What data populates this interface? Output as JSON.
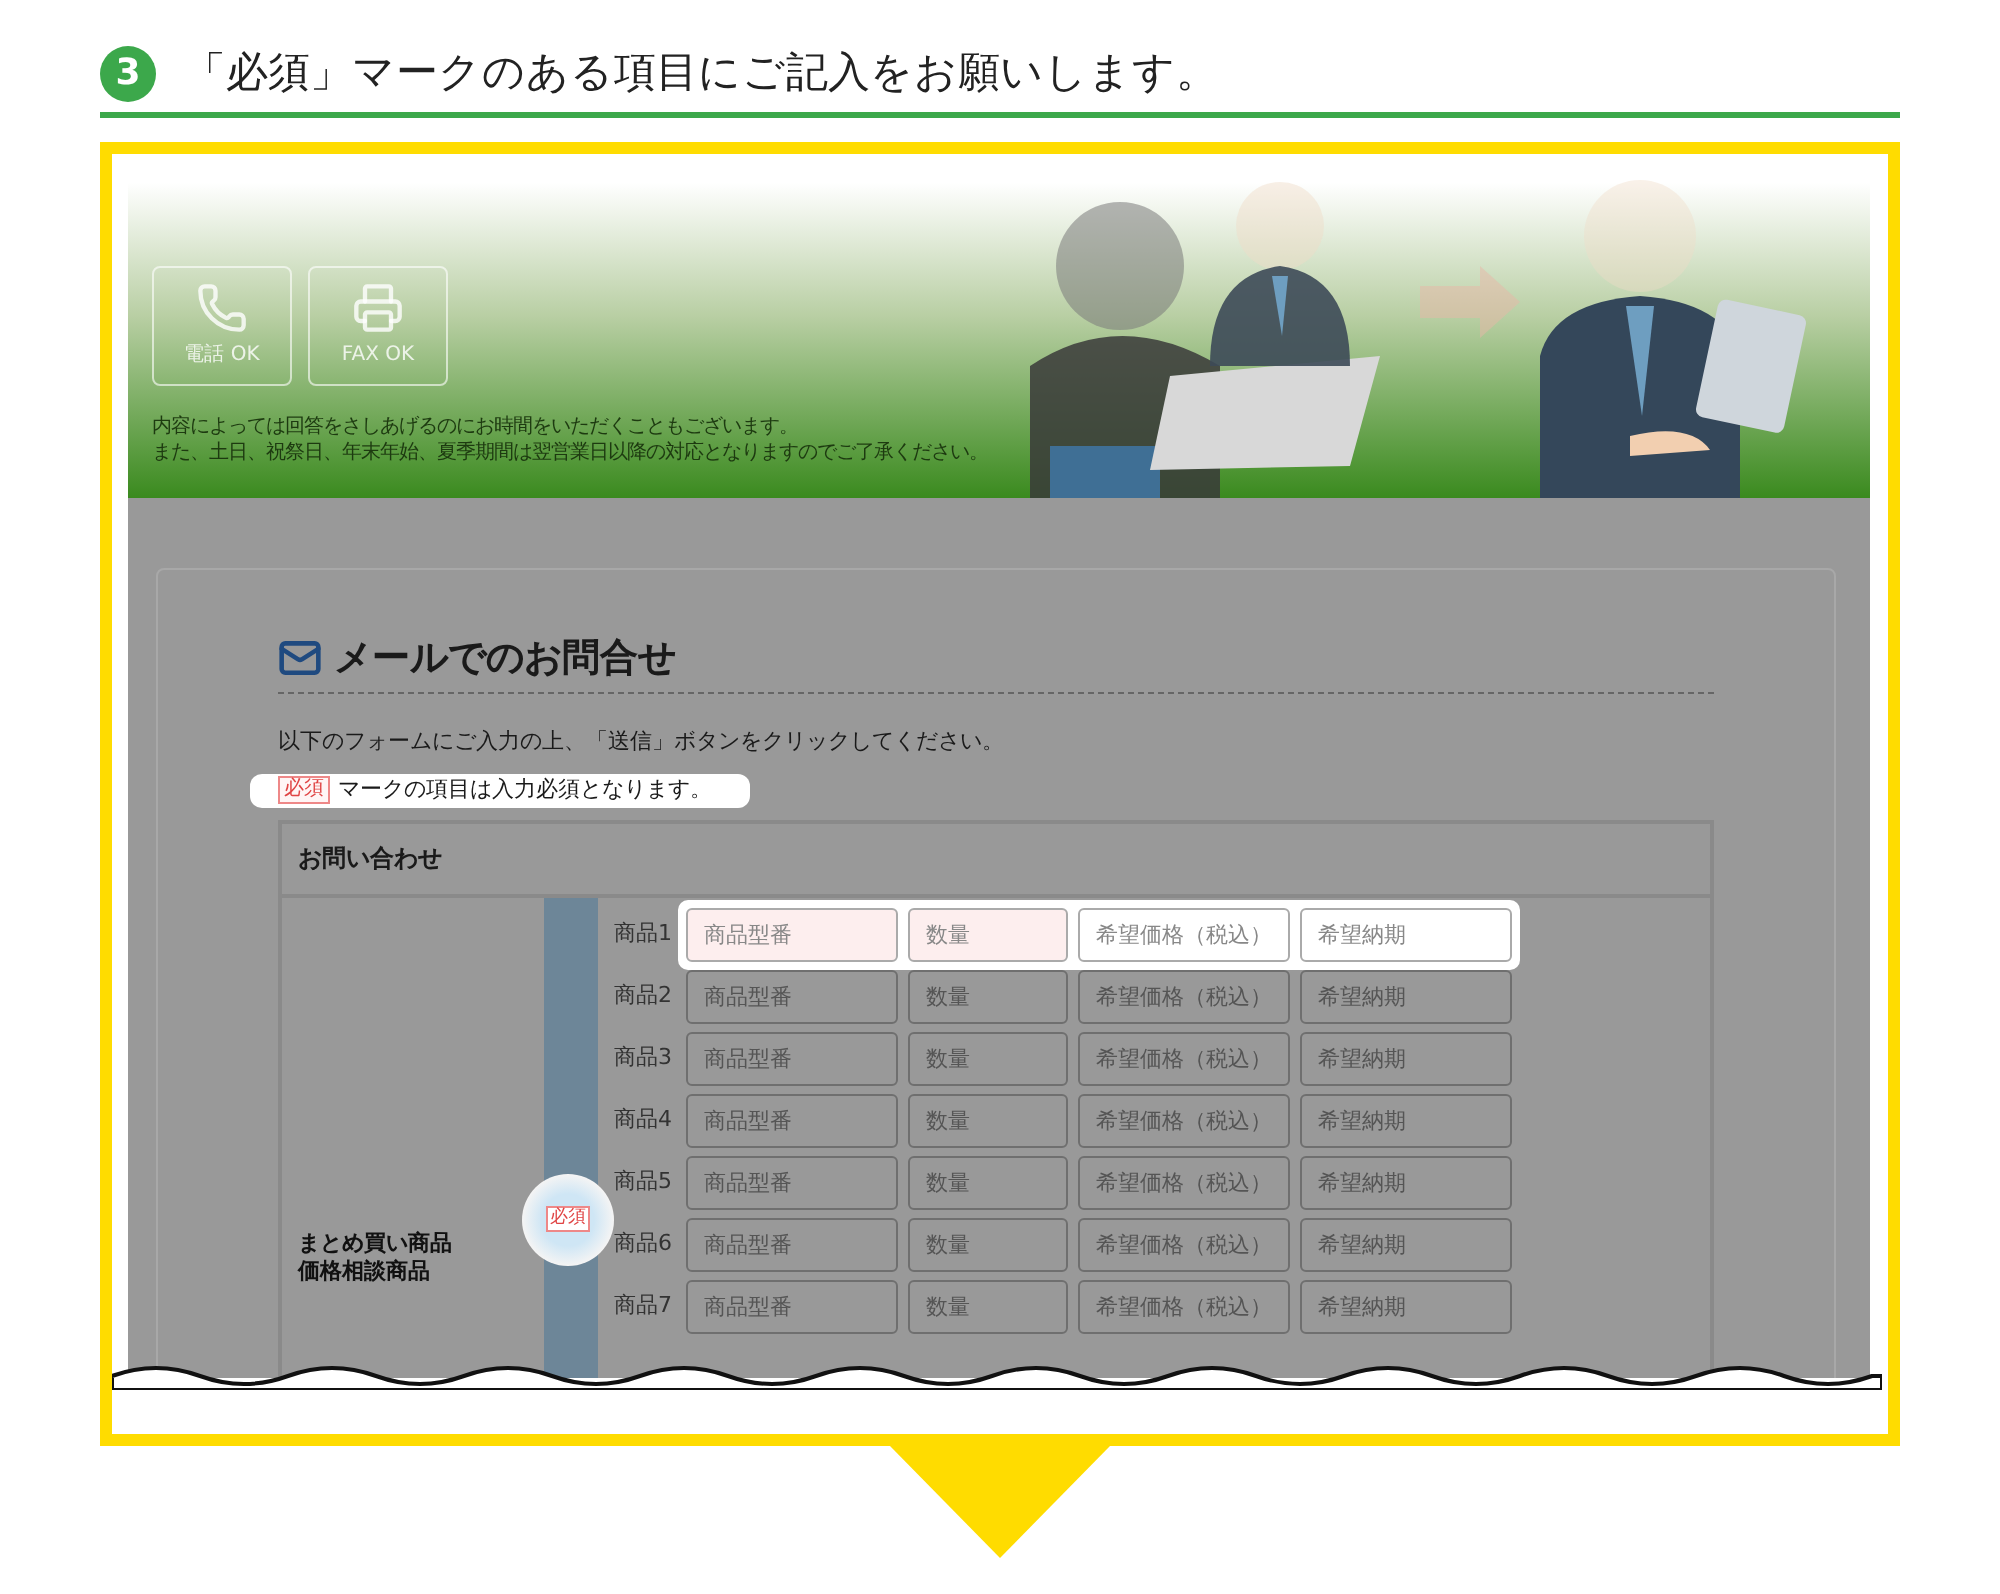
{
  "step": {
    "number": "3",
    "title": "「必須」マークのある項目にご記入をお願いします。"
  },
  "banner": {
    "contact_buttons": [
      {
        "kind": "phone",
        "label": "電話 OK"
      },
      {
        "kind": "fax",
        "label": "FAX OK"
      }
    ],
    "notes": [
      "内容によっては回答をさしあげるのにお時間をいただくこともございます。",
      "また、土日、祝祭日、年末年始、夏季期間は翌営業日以降の対応となりますのでご了承ください。"
    ]
  },
  "form": {
    "heading": "メールでのお問合せ",
    "instruction": "以下のフォームにご入力の上、「送信」ボタンをクリックしてください。",
    "required_note": {
      "badge": "必須",
      "text": "マークの項目は入力必須となります。",
      "highlighted": true
    },
    "section_title": "お問い合わせ",
    "group": {
      "label_lines": [
        "まとめ買い商品",
        "価格相談商品"
      ],
      "required_badge": "必須",
      "badge_highlighted": true,
      "rows": [
        {
          "label": "商品1",
          "highlighted": true,
          "fields": [
            {
              "placeholder": "商品型番",
              "required": true
            },
            {
              "placeholder": "数量",
              "required": true
            },
            {
              "placeholder": "希望価格（税込）",
              "required": false
            },
            {
              "placeholder": "希望納期",
              "required": false
            }
          ]
        },
        {
          "label": "商品2",
          "highlighted": false,
          "fields": [
            {
              "placeholder": "商品型番"
            },
            {
              "placeholder": "数量"
            },
            {
              "placeholder": "希望価格（税込）"
            },
            {
              "placeholder": "希望納期"
            }
          ]
        },
        {
          "label": "商品3",
          "highlighted": false,
          "fields": [
            {
              "placeholder": "商品型番"
            },
            {
              "placeholder": "数量"
            },
            {
              "placeholder": "希望価格（税込）"
            },
            {
              "placeholder": "希望納期"
            }
          ]
        },
        {
          "label": "商品4",
          "highlighted": false,
          "fields": [
            {
              "placeholder": "商品型番"
            },
            {
              "placeholder": "数量"
            },
            {
              "placeholder": "希望価格（税込）"
            },
            {
              "placeholder": "希望納期"
            }
          ]
        },
        {
          "label": "商品5",
          "highlighted": false,
          "fields": [
            {
              "placeholder": "商品型番"
            },
            {
              "placeholder": "数量"
            },
            {
              "placeholder": "希望価格（税込）"
            },
            {
              "placeholder": "希望納期"
            }
          ]
        },
        {
          "label": "商品6",
          "highlighted": false,
          "fields": [
            {
              "placeholder": "商品型番"
            },
            {
              "placeholder": "数量"
            },
            {
              "placeholder": "希望価格（税込）"
            },
            {
              "placeholder": "希望納期"
            }
          ]
        },
        {
          "label": "商品7",
          "highlighted": false,
          "fields": [
            {
              "placeholder": "商品型番"
            },
            {
              "placeholder": "数量"
            },
            {
              "placeholder": "希望価格（税込）"
            },
            {
              "placeholder": "希望納期"
            }
          ]
        }
      ]
    }
  }
}
